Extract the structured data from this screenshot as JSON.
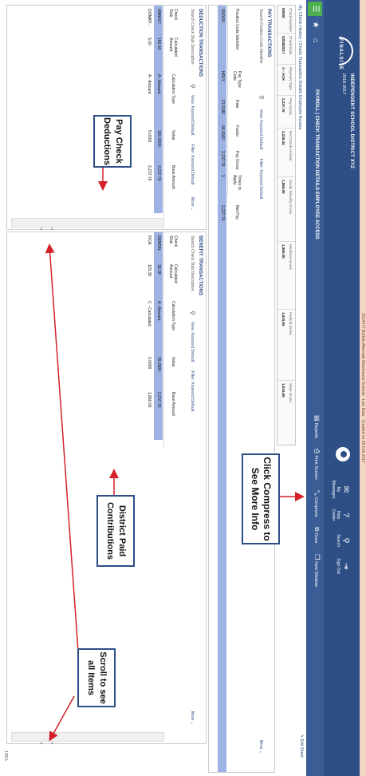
{
  "banner": "2014477 Buffalo Alternate Warehouse Schools · Live Data · Created on 08 Feb 2017",
  "header": {
    "logo_text": "FINALSITE",
    "district": "INDEPENDENT SCHOOL DISTRICT XYZ",
    "year": "2016-2017",
    "icons": [
      {
        "name": "my-messages",
        "icon": "envelope-icon",
        "label": "My Messages"
      },
      {
        "name": "help-center",
        "icon": "help-icon",
        "label": "Help Center"
      },
      {
        "name": "search",
        "icon": "search-icon",
        "label": "Search"
      },
      {
        "name": "sign-out",
        "icon": "signout-icon",
        "label": "Sign Out"
      }
    ]
  },
  "subbar": {
    "title": "PAYROLL | CHECK TRANSACTION DETAILS EMPLOYEE ACCESS",
    "tools": [
      {
        "name": "reports",
        "label": "Reports"
      },
      {
        "name": "print-screen",
        "label": "Print Screen"
      },
      {
        "name": "compress",
        "label": "Compress"
      },
      {
        "name": "docs",
        "label": "Docs"
      },
      {
        "name": "new-window",
        "label": "New Window"
      }
    ]
  },
  "breadcrumb": "My Check History | Check Transaction Details Employee Access",
  "edit_sheet": "Edit Sheet",
  "summary": [
    {
      "h": "Check Number",
      "v": "00000"
    },
    {
      "h": "Check Date",
      "v": "03/28/2017"
    },
    {
      "h": "Payment Type",
      "v": "A - ACH"
    },
    {
      "h": "Pay Gross",
      "v": "2,237.76"
    },
    {
      "h": "Net Check Amount",
      "v": "2,238.44"
    },
    {
      "h": "Social Security Gross",
      "v": "1,860.00"
    },
    {
      "h": "Medicare Gross",
      "v": "1,860.00"
    },
    {
      "h": "Federal Gross",
      "v": "1,815.65"
    },
    {
      "h": "State Gross",
      "v": "1,815.65"
    }
  ],
  "pay": {
    "title": "PAY TRANSACTIONS",
    "search_label": "Search Position Code Identifier",
    "filter_view": "View: Keyword Default",
    "filter": "Filter: Keyword Default",
    "more": "More",
    "columns": [
      "Position Code Identifier",
      "Pay Type Code",
      "Rate",
      "Factor",
      "Pay Gross",
      "Times to Apply",
      "Net Pay"
    ],
    "rows": [
      [
        "00/0/00",
        "HRLY",
        "23.5180",
        "96.0000",
        "2,237.76",
        "1",
        "2,237.76"
      ]
    ]
  },
  "deduction": {
    "title": "DEDUCTION TRANSACTIONS",
    "search_label": "Search Check Stub Description",
    "filter_view": "View: Keyword Default",
    "filter": "Filter: Keyword Default",
    "more": "More",
    "columns": [
      "Check Stub",
      "Calculated Amount",
      "Calculation Type",
      "Value",
      "Base Amount"
    ],
    "rows": [
      [
        "ANNUIT...",
        "180.00",
        "A - Amount",
        "180.0000",
        "2,237.76"
      ],
      [
        "DONATI...",
        "5.00",
        "A - Amount",
        "5.0000",
        "2,237.76"
      ]
    ]
  },
  "benefit": {
    "title": "BENEFIT TRANSACTIONS",
    "search_label": "Search Check Stub Description",
    "filter_view": "View: Keyword Default",
    "filter": "Filter: Keyword Default",
    "more": "More",
    "columns": [
      "Check Stub",
      "Calculated Amount",
      "Calculation Type",
      "Value",
      "Base Amount"
    ],
    "rows": [
      [
        "DENTAL",
        "39.28",
        "A - Amount",
        "39.2800",
        "2,237.76"
      ],
      [
        "FICA",
        "115.38",
        "C - Calculated",
        "0.0000",
        "1,860.00"
      ]
    ]
  },
  "callouts": {
    "deductions": "Pay Check Deductions",
    "district": "District Paid Contributions",
    "compress": "Click Compress to See More Info",
    "scroll": "Scroll to see all Items"
  },
  "zoom": "125%",
  "colors": {
    "header": "#2e4e86",
    "row_highlight": "#9eb3e3",
    "arrow": "#d4202a"
  }
}
